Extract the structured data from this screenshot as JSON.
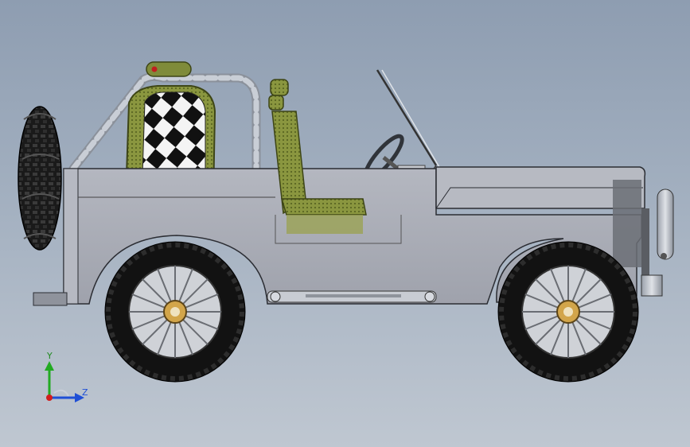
{
  "viewport": {
    "background_top": "#8e9db1",
    "background_bottom": "#bfc7d1"
  },
  "model": {
    "subject": "off-road-jeep",
    "colors": {
      "body": "#a9acb6",
      "body_light": "#b9bcc5",
      "tire": "#141414",
      "rim": "#e8e8e8",
      "seat_fabric": "#7f8b3a",
      "roll_bar": "#b8bec8",
      "checker_dark": "#111111",
      "checker_light": "#f4f4f4"
    }
  },
  "triad": {
    "y_label": "Y",
    "z_label": "Z",
    "y_color": "#22aa22",
    "z_color": "#1f4fd6",
    "origin_color": "#d21d1d"
  }
}
